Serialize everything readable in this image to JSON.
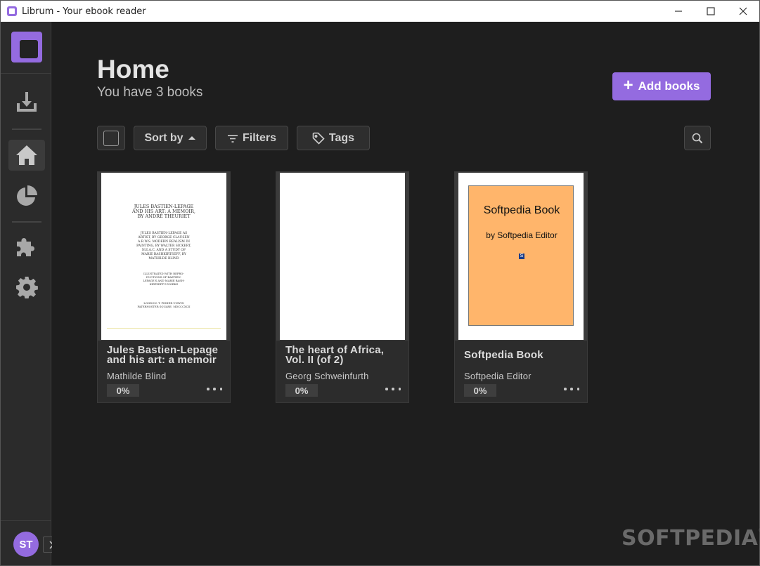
{
  "window": {
    "title": "Librum - Your ebook reader"
  },
  "sidebar": {
    "items": [
      {
        "name": "download"
      },
      {
        "name": "home"
      },
      {
        "name": "statistics"
      },
      {
        "name": "plugins"
      },
      {
        "name": "settings"
      }
    ],
    "avatar_initials": "ST"
  },
  "header": {
    "title": "Home",
    "subtitle": "You have 3 books",
    "add_books_label": "Add books"
  },
  "toolbar": {
    "sort_label": "Sort by",
    "filters_label": "Filters",
    "tags_label": "Tags"
  },
  "books": [
    {
      "title": "Jules Bastien-Lepage and his art: a memoir",
      "author": "Mathilde Blind",
      "progress": "0%",
      "cover_lines": [
        "JULES BASTIEN-LEPAGE",
        "AND HIS ART: A MEMOIR,",
        "BY ANDRÉ THEURIET",
        "JULES BASTIEN-LEPAGE AS",
        "ARTIST, BY GEORGE CLAUSEN",
        "A.R.W.S. MODERN REALISM IN",
        "PAINTING, BY WALTER SICKERT,",
        "N.E.A.C. AND A STUDY OF",
        "MARIE BASHKIRTSEFF, BY",
        "MATHILDE BLIND",
        "ILLUSTRATED WITH REPRO-",
        "DUCTIONS OF BASTIEN-",
        "LEPAGE'S AND MARIE BASH-",
        "KIRTSEFF'S WORKS",
        "LONDON: T. FISHER UNWIN",
        "PATERNOSTER SQUARE. MDCCCXCII"
      ]
    },
    {
      "title": "The heart of Africa, Vol. II (of 2)",
      "author": "Georg Schweinfurth",
      "progress": "0%"
    },
    {
      "title": "Softpedia Book",
      "author": "Softpedia Editor",
      "progress": "0%",
      "cover_title": "Softpedia Book",
      "cover_byline": "by Softpedia Editor",
      "cover_mark": "S"
    }
  ],
  "watermark": {
    "text": "SOFTPEDIA",
    "mark": "®"
  },
  "colors": {
    "accent": "#946be0",
    "background": "#1e1e1e",
    "sidebar": "#2b2b2b",
    "card": "#2c2c2c",
    "cover_orange": "#ffb56b"
  }
}
